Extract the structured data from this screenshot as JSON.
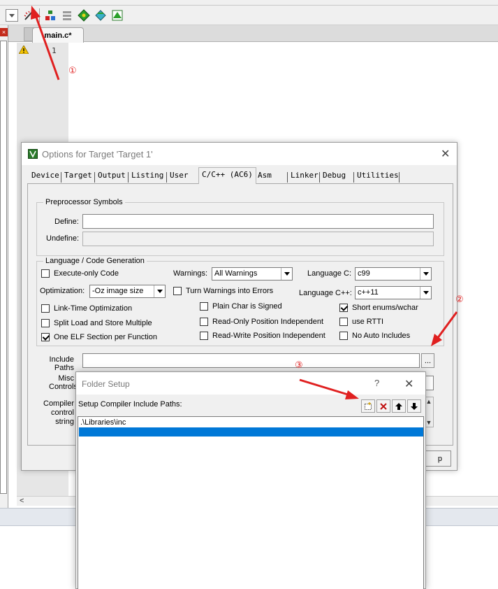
{
  "editor": {
    "tab_label": "main.c*",
    "line_number": "1"
  },
  "options_dialog": {
    "title": "Options for Target 'Target 1'",
    "close_glyph": "✕",
    "tabs": [
      {
        "label": "Device"
      },
      {
        "label": "Target"
      },
      {
        "label": "Output"
      },
      {
        "label": "Listing"
      },
      {
        "label": "User"
      },
      {
        "label": "C/C++ (AC6)",
        "active": true
      },
      {
        "label": "Asm"
      },
      {
        "label": "Linker"
      },
      {
        "label": "Debug"
      },
      {
        "label": "Utilities"
      }
    ],
    "preprocessor": {
      "group_label": "Preprocessor Symbols",
      "define_label": "Define:",
      "define_value": "",
      "undefine_label": "Undefine:",
      "undefine_value": ""
    },
    "language": {
      "group_label": "Language / Code Generation",
      "execute_only": {
        "label": "Execute-only Code",
        "checked": false
      },
      "warnings_label": "Warnings:",
      "warnings_value": "All Warnings",
      "language_c_label": "Language C:",
      "language_c_value": "c99",
      "optimization_label": "Optimization:",
      "optimization_value": "-Oz image size",
      "turn_warnings": {
        "label": "Turn Warnings into Errors",
        "checked": false
      },
      "language_cpp_label": "Language C++:",
      "language_cpp_value": "c++11",
      "lto": {
        "label": "Link-Time Optimization",
        "checked": false
      },
      "plain_char": {
        "label": "Plain Char is Signed",
        "checked": false
      },
      "short_enums": {
        "label": "Short enums/wchar",
        "checked": true
      },
      "split_load": {
        "label": "Split Load and Store Multiple",
        "checked": false
      },
      "ro_pi": {
        "label": "Read-Only Position Independent",
        "checked": false
      },
      "rtti": {
        "label": "use RTTI",
        "checked": false
      },
      "one_elf": {
        "label": "One ELF Section per Function",
        "checked": true
      },
      "rw_pi": {
        "label": "Read-Write Position Independent",
        "checked": false
      },
      "no_auto": {
        "label": "No Auto Includes",
        "checked": false
      }
    },
    "include_paths": {
      "label_line1": "Include",
      "label_line2": "Paths",
      "value": "",
      "browse_label": "..."
    },
    "misc_controls": {
      "label_line1": "Misc",
      "label_line2": "Controls"
    },
    "compiler_string": {
      "label_line1": "Compiler",
      "label_line2": "control",
      "label_line3": "string"
    },
    "partial_button_text": "p"
  },
  "folder_setup": {
    "title": "Folder Setup",
    "help_glyph": "?",
    "close_glyph": "✕",
    "header": "Setup Compiler Include Paths:",
    "paths": [
      ".\\Libraries\\inc"
    ]
  },
  "annotations": {
    "marker_1": "①",
    "marker_2": "②",
    "marker_3": "③",
    "arrow_color": "#e02020"
  },
  "colors": {
    "selection": "#0078d7",
    "dialog_bg": "#f0f0f0"
  }
}
